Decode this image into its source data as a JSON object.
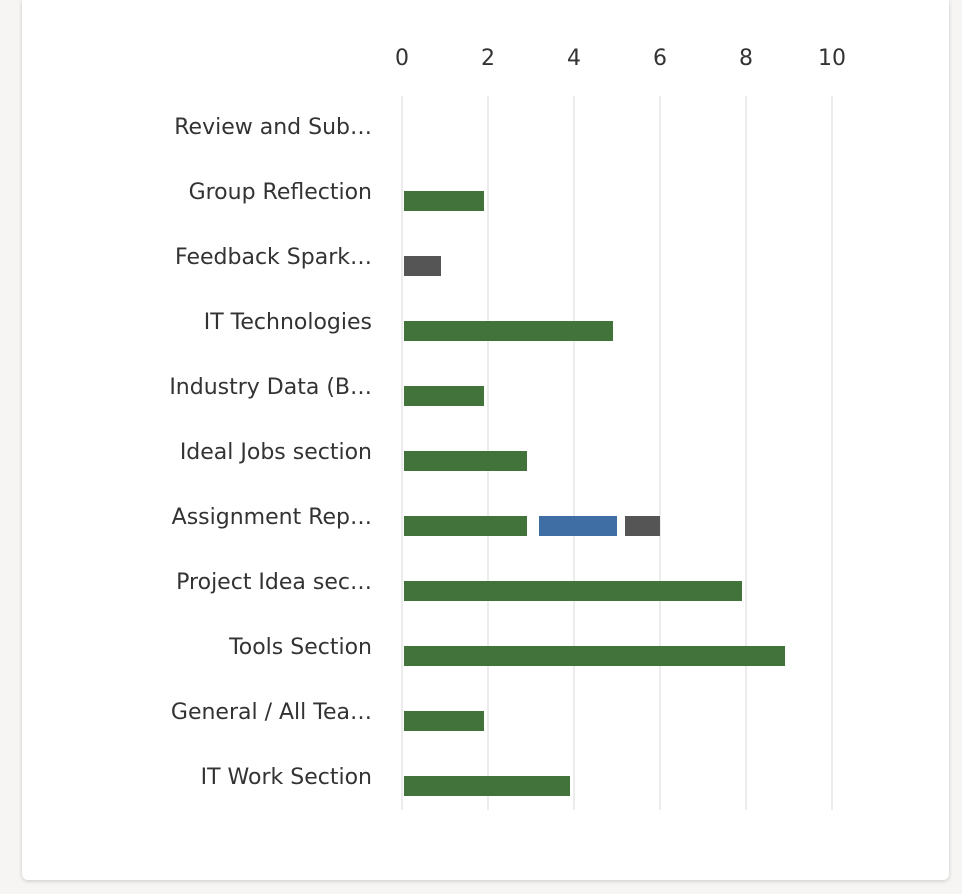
{
  "chart_data": {
    "type": "bar",
    "orientation": "horizontal",
    "x_ticks": [
      "0",
      "2",
      "4",
      "6",
      "8",
      "10"
    ],
    "xlim": [
      0,
      10
    ],
    "grid": true,
    "categories": [
      "Review and Sub…",
      "Group Reflection",
      "Feedback Spark…",
      "IT Technologies",
      "Industry Data (B…",
      "Ideal Jobs section",
      "Assignment Rep…",
      "Project Idea sec…",
      "Tools Section",
      "General / All Tea…",
      "IT Work Section"
    ],
    "series": [
      {
        "color": "#42733a",
        "values": [
          0,
          2,
          0,
          5,
          2,
          3,
          3,
          8,
          9,
          2,
          4
        ]
      },
      {
        "color": "#3e6ea3",
        "values": [
          0,
          0,
          0,
          0,
          0,
          0,
          2,
          0,
          0,
          0,
          0
        ]
      },
      {
        "color": "#555555",
        "values": [
          0,
          0,
          1,
          0,
          0,
          0,
          1,
          0,
          0,
          0,
          0
        ]
      }
    ]
  }
}
